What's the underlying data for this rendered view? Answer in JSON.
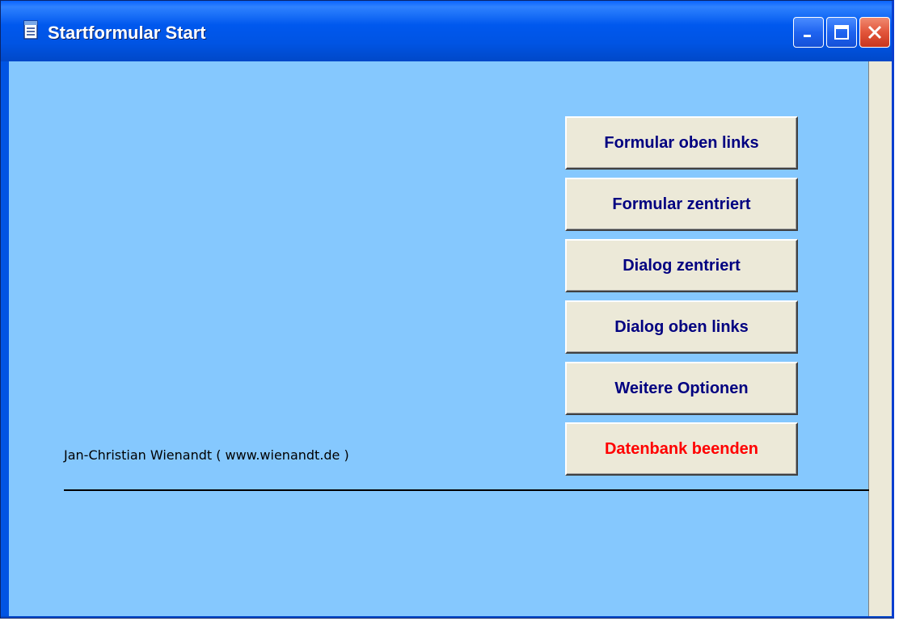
{
  "window": {
    "title": "Startformular Start",
    "icon": "form-icon",
    "controls": [
      "minimize-icon",
      "maximize-icon",
      "close-icon"
    ]
  },
  "buttons": [
    {
      "label": "Formular oben links",
      "color": "#000080"
    },
    {
      "label": "Formular zentriert",
      "color": "#000080"
    },
    {
      "label": "Dialog zentriert",
      "color": "#000080"
    },
    {
      "label": "Dialog oben links",
      "color": "#000080"
    },
    {
      "label": "Weitere Optionen",
      "color": "#000080"
    },
    {
      "label": "Datenbank beenden",
      "color": "#ff0000"
    }
  ],
  "footer": {
    "credit": "Jan-Christian Wienandt ( www.wienandt.de )"
  },
  "colors": {
    "client_background": "#85c8fe",
    "titlebar": "#0058ee",
    "button_face": "#ece9d8"
  }
}
